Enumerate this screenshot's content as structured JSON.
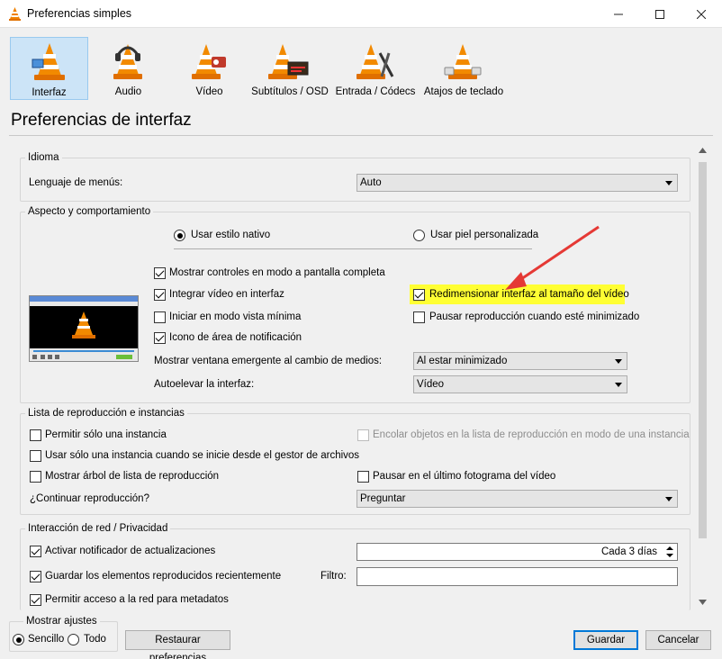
{
  "window": {
    "title": "Preferencias simples"
  },
  "categories": [
    {
      "label": "Interfaz",
      "icon": "interface-cone-icon",
      "selected": true
    },
    {
      "label": "Audio",
      "icon": "audio-cone-icon"
    },
    {
      "label": "Vídeo",
      "icon": "video-cone-icon"
    },
    {
      "label": "Subtítulos / OSD",
      "icon": "subtitles-cone-icon"
    },
    {
      "label": "Entrada / Códecs",
      "icon": "input-codecs-cone-icon"
    },
    {
      "label": "Atajos de teclado",
      "icon": "hotkeys-cone-icon"
    }
  ],
  "header": "Preferencias de interfaz",
  "idioma": {
    "title": "Idioma",
    "menu_lang_label": "Lenguaje de menús:",
    "menu_lang_value": "Auto"
  },
  "aspecto": {
    "title": "Aspecto y comportamiento",
    "native_style": "Usar estilo nativo",
    "custom_skin": "Usar piel personalizada",
    "fullscreen_controls": "Mostrar controles en modo a pantalla completa",
    "embed_video": "Integrar vídeo en interfaz",
    "resize_interface": "Redimensionar interfaz al tamaño del vídeo",
    "start_minimal": "Iniciar en modo vista mínima",
    "pause_minimized": "Pausar reproducción cuando esté minimizado",
    "systray_icon": "Icono de área de notificación",
    "popup_label": "Mostrar ventana emergente al cambio de medios:",
    "popup_value": "Al estar minimizado",
    "raise_label": "Autoelevar la interfaz:",
    "raise_value": "Vídeo"
  },
  "lista": {
    "title": "Lista de reproducción e instancias",
    "one_instance": "Permitir sólo una instancia",
    "enqueue": "Encolar objetos en la lista de reproducción en modo de una instancia",
    "one_instance_fm": "Usar sólo una instancia cuando se inicie desde el gestor de archivos",
    "tree": "Mostrar árbol de lista de reproducción",
    "pause_last": "Pausar en el último fotograma del vídeo",
    "continue_label": "¿Continuar reproducción?",
    "continue_value": "Preguntar"
  },
  "red": {
    "title": "Interacción de red / Privacidad",
    "update_notifier": "Activar notificador de actualizaciones",
    "update_interval": "Cada 3 días",
    "save_recent": "Guardar los elementos reproducidos recientemente",
    "filter_label": "Filtro:",
    "metadata_access": "Permitir acceso a la red para metadatos"
  },
  "footer": {
    "show_settings": "Mostrar ajustes",
    "simple": "Sencillo",
    "all": "Todo",
    "reset": "Restaurar preferencias",
    "save": "Guardar",
    "cancel": "Cancelar"
  },
  "colors": {
    "highlight": "#ffff33",
    "arrow": "#e53935",
    "selection": "#cce4f7"
  }
}
